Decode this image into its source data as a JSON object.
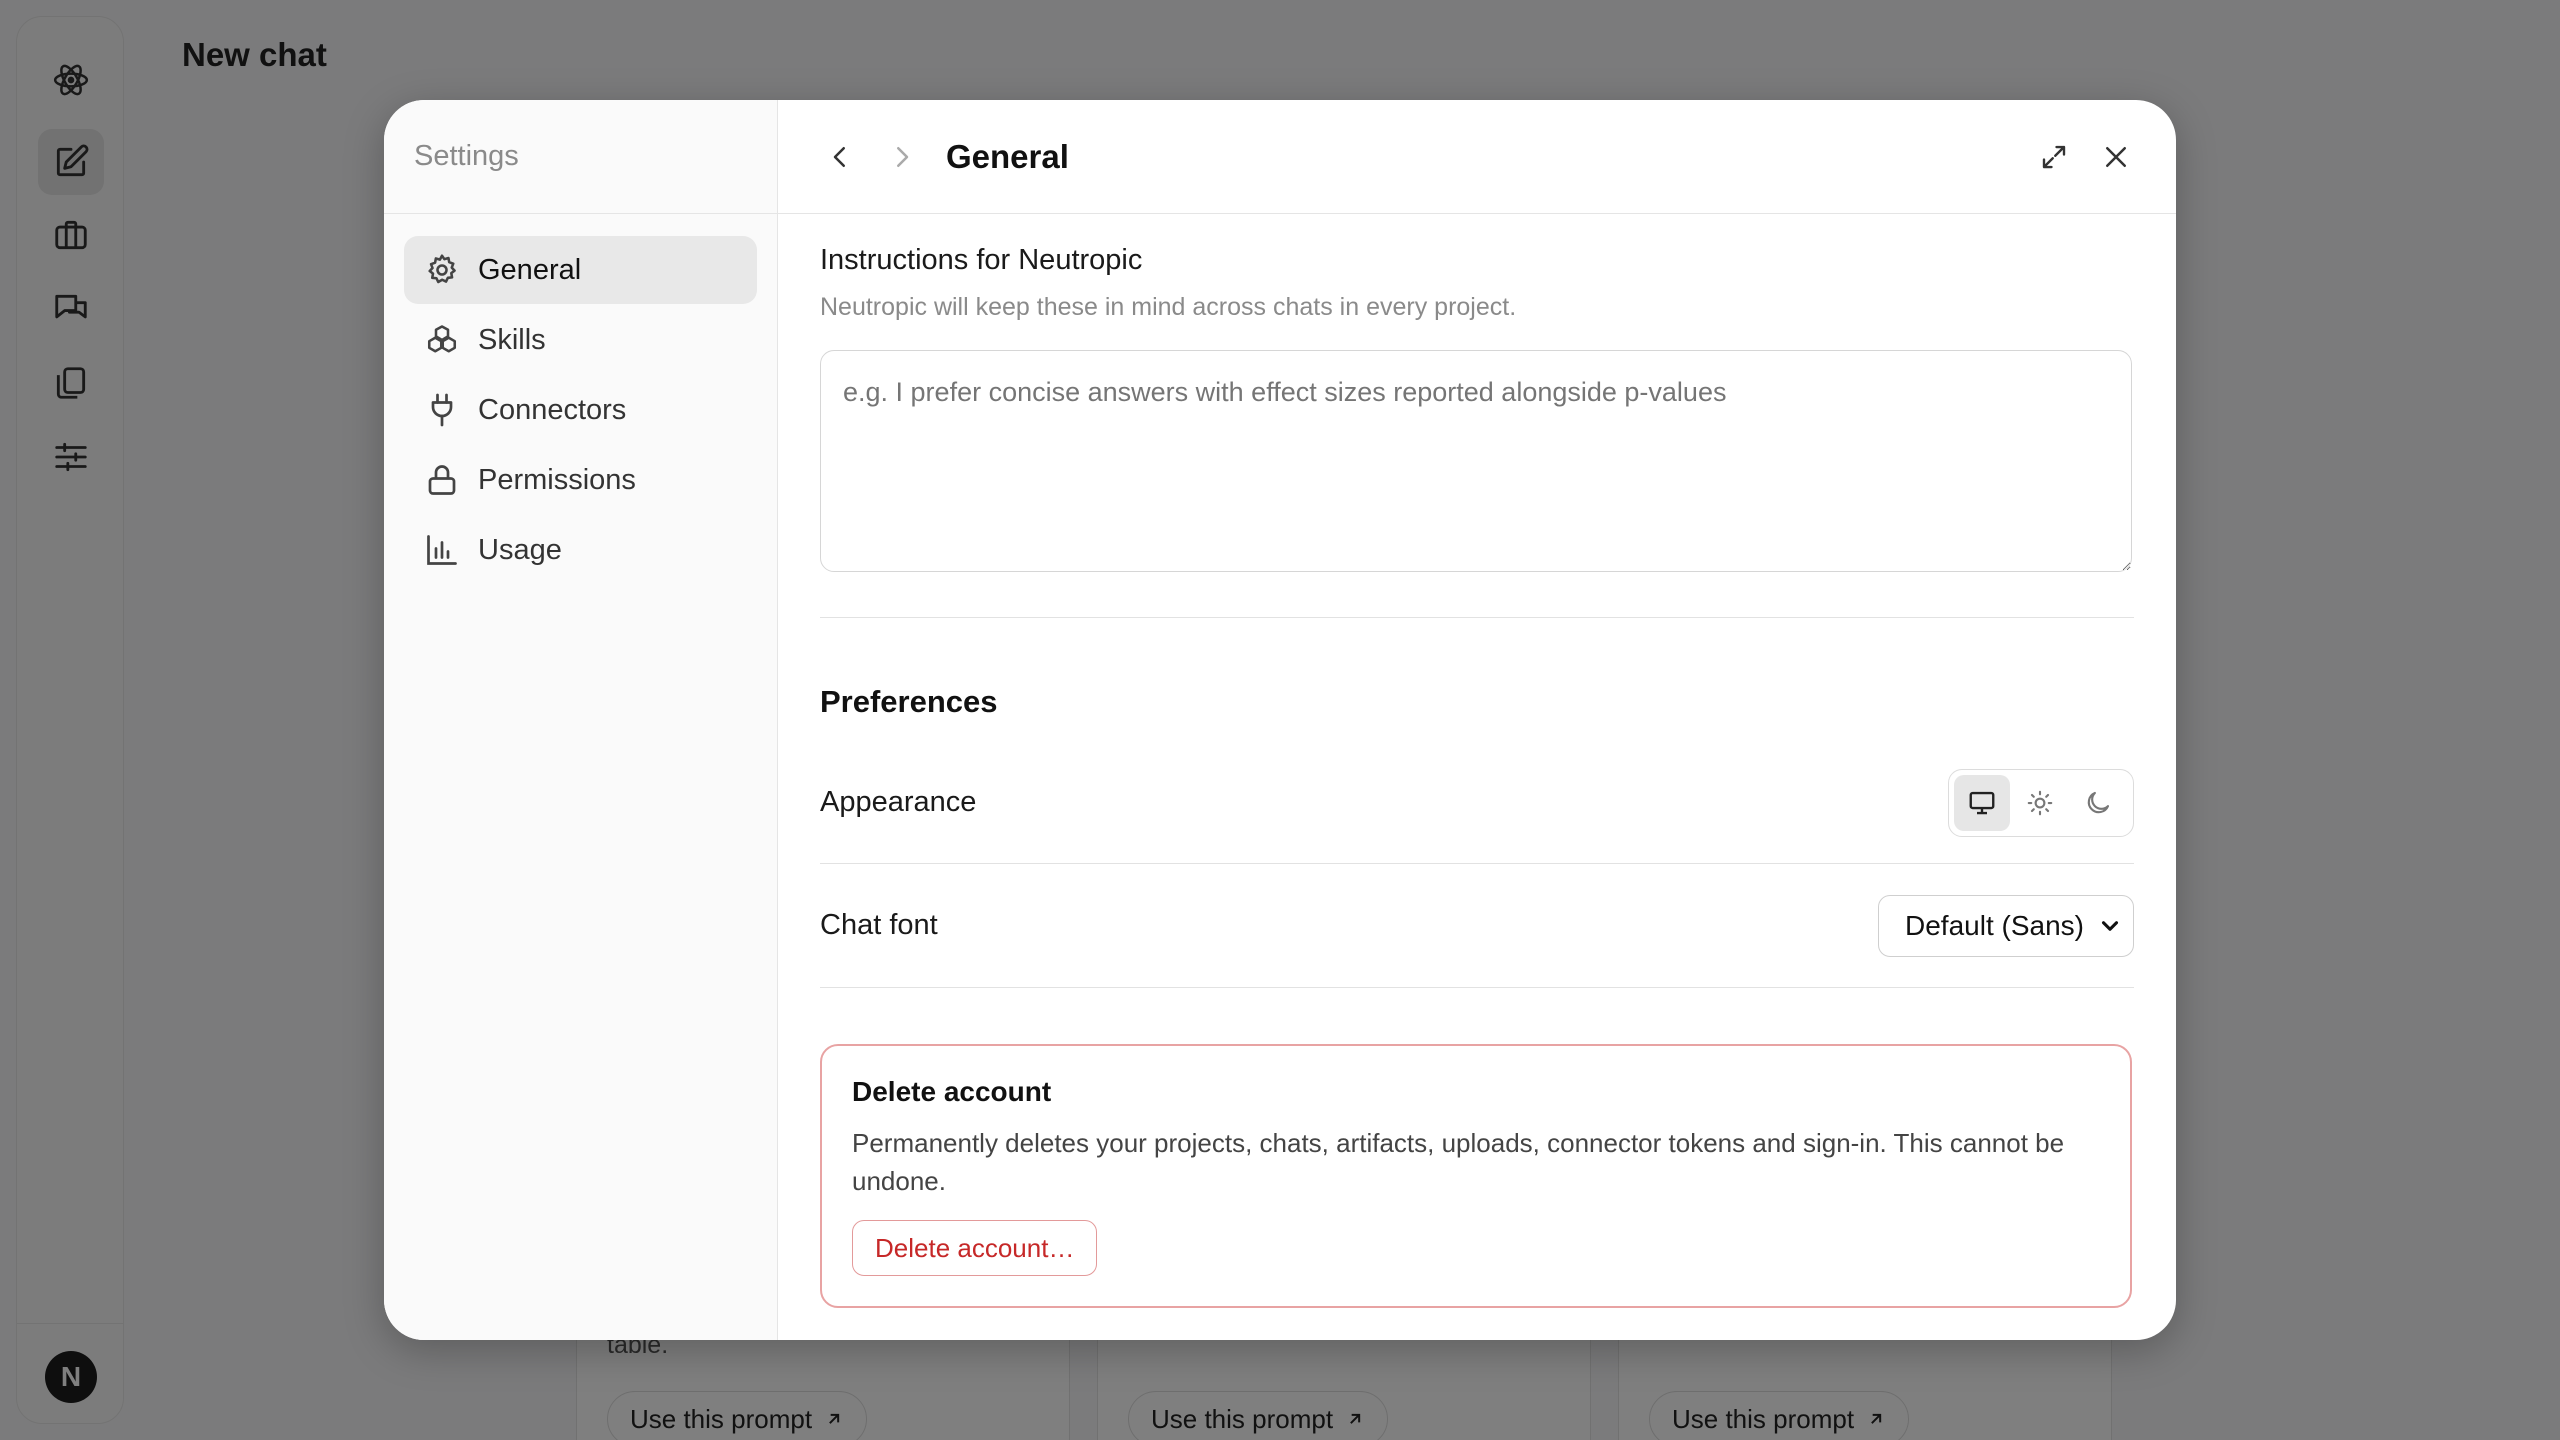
{
  "background": {
    "page_title": "New chat",
    "avatar_initial": "N",
    "rail_icons": [
      "atom-logo-icon",
      "new-chat-icon",
      "briefcase-icon",
      "chats-icon",
      "documents-icon",
      "sliders-icon"
    ],
    "cards": [
      {
        "snippet": "table.",
        "button": "Use this prompt"
      },
      {
        "snippet": "",
        "button": "Use this prompt"
      },
      {
        "snippet": "",
        "button": "Use this prompt"
      }
    ]
  },
  "settings": {
    "title": "Settings",
    "nav": [
      {
        "label": "General",
        "icon": "gear-icon",
        "active": true
      },
      {
        "label": "Skills",
        "icon": "skills-icon",
        "active": false
      },
      {
        "label": "Connectors",
        "icon": "plug-icon",
        "active": false
      },
      {
        "label": "Permissions",
        "icon": "lock-icon",
        "active": false
      },
      {
        "label": "Usage",
        "icon": "bar-chart-icon",
        "active": false
      }
    ],
    "header": {
      "title": "General"
    },
    "instructions": {
      "label": "Instructions for Neutropic",
      "sublabel": "Neutropic will keep these in mind across chats in every project.",
      "placeholder": "e.g. I prefer concise answers with effect sizes reported alongside p-values",
      "value": ""
    },
    "preferences": {
      "title": "Preferences",
      "appearance_label": "Appearance",
      "appearance_options": [
        "system-icon",
        "light-icon",
        "dark-icon"
      ],
      "appearance_selected": "system",
      "chat_font_label": "Chat font",
      "chat_font_value": "Default (Sans)"
    },
    "danger": {
      "title": "Delete account",
      "description": "Permanently deletes your projects, chats, artifacts, uploads, connector tokens and sign-in. This cannot be undone.",
      "button": "Delete account…",
      "accent": "#c62828"
    }
  }
}
